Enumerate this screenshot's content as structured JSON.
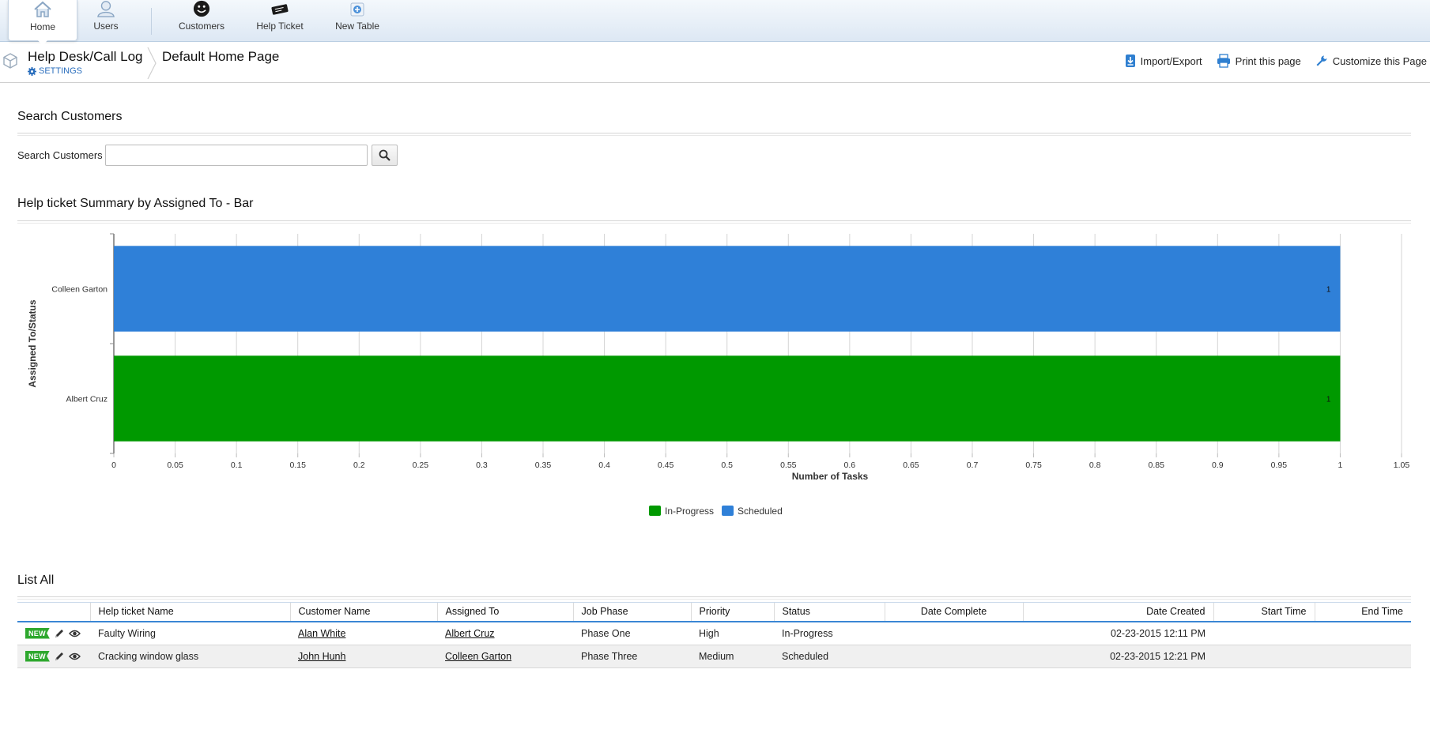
{
  "tabs": [
    {
      "label": "Home",
      "icon": "home-icon",
      "active": true
    },
    {
      "label": "Users",
      "icon": "user-icon",
      "active": false
    },
    {
      "label": "Customers",
      "icon": "smiley-icon",
      "active": false
    },
    {
      "label": "Help Ticket",
      "icon": "ticket-icon",
      "active": false
    },
    {
      "label": "New Table",
      "icon": "add-table-icon",
      "active": false
    }
  ],
  "header": {
    "app_title": "Help Desk/Call Log",
    "settings_label": "SETTINGS",
    "page_title": "Default Home Page",
    "actions": {
      "import_export": "Import/Export",
      "print": "Print this page",
      "customize": "Customize this Page"
    }
  },
  "search": {
    "section_title": "Search Customers",
    "label": "Search Customers",
    "value": "",
    "placeholder": ""
  },
  "chart_section": {
    "title": "Help ticket Summary by Assigned To - Bar"
  },
  "chart_data": {
    "type": "bar",
    "orientation": "horizontal",
    "title": "Help ticket Summary by Assigned To - Bar",
    "xlabel": "Number of Tasks",
    "ylabel": "Assigned To/Status",
    "categories": [
      "Colleen Garton",
      "Albert Cruz"
    ],
    "series": [
      {
        "name": "In-Progress",
        "color": "#009900",
        "values": [
          0,
          1
        ]
      },
      {
        "name": "Scheduled",
        "color": "#2f80d8",
        "values": [
          1,
          0
        ]
      }
    ],
    "data_labels": [
      "1",
      "1"
    ],
    "xlim": [
      0,
      1.05
    ],
    "xticks": [
      "0",
      "0.05",
      "0.1",
      "0.15",
      "0.2",
      "0.25",
      "0.3",
      "0.35",
      "0.4",
      "0.45",
      "0.5",
      "0.55",
      "0.6",
      "0.65",
      "0.7",
      "0.75",
      "0.8",
      "0.85",
      "0.9",
      "0.95",
      "1",
      "1.05"
    ],
    "grid": true,
    "legend": "bottom-center"
  },
  "list": {
    "section_title": "List All",
    "badge": "NEW",
    "columns": [
      "Help ticket Name",
      "Customer Name",
      "Assigned To",
      "Job Phase",
      "Priority",
      "Status",
      "Date Complete",
      "Date Created",
      "Start Time",
      "End Time"
    ],
    "rows": [
      {
        "name": "Faulty Wiring",
        "customer": "Alan White",
        "assigned": "Albert Cruz",
        "phase": "Phase One",
        "priority": "High",
        "status": "In-Progress",
        "date_complete": "",
        "date_created": "02-23-2015 12:11 PM",
        "start": "",
        "end": ""
      },
      {
        "name": "Cracking window glass",
        "customer": "John Hunh",
        "assigned": "Colleen Garton",
        "phase": "Phase Three",
        "priority": "Medium",
        "status": "Scheduled",
        "date_complete": "",
        "date_created": "02-23-2015 12:21 PM",
        "start": "",
        "end": ""
      }
    ]
  }
}
